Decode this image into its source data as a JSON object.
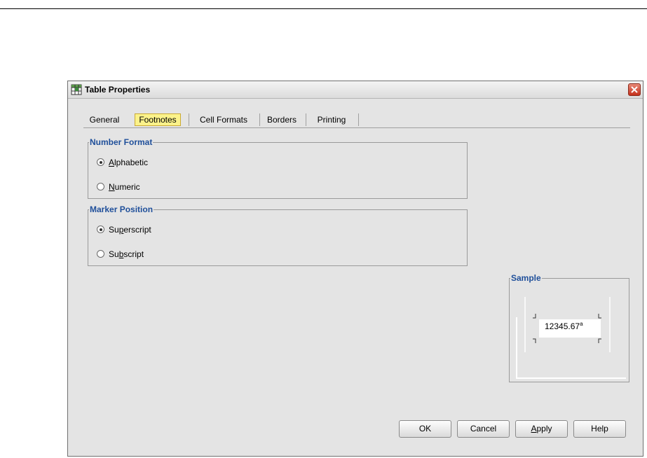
{
  "window": {
    "title": "Table Properties"
  },
  "tabs": [
    {
      "label": "General",
      "active": false
    },
    {
      "label": "Footnotes",
      "active": true
    },
    {
      "label": "Cell Formats",
      "active": false
    },
    {
      "label": "Borders",
      "active": false
    },
    {
      "label": "Printing",
      "active": false
    }
  ],
  "number_format": {
    "legend": "Number Format",
    "options": [
      {
        "label": "Alphabetic",
        "mnemonic": "A",
        "checked": true
      },
      {
        "label": "Numeric",
        "mnemonic": "N",
        "checked": false
      }
    ]
  },
  "marker_position": {
    "legend": "Marker Position",
    "options": [
      {
        "label": "Superscript",
        "mnemonic": "p",
        "checked": true
      },
      {
        "label": "Subscript",
        "mnemonic": "b",
        "checked": false
      }
    ]
  },
  "sample": {
    "legend": "Sample",
    "value": "12345.67",
    "marker": "a"
  },
  "buttons": {
    "ok": "OK",
    "cancel": "Cancel",
    "apply": "Apply",
    "apply_mnemonic": "A",
    "help": "Help"
  },
  "colors": {
    "legend_text": "#1f4f9a",
    "active_tab": "#fbf28a",
    "dialog_bg": "#e4e4e4",
    "close_button": "#c4301c"
  },
  "icons": {
    "app": "table-grid-icon",
    "close": "close-icon"
  }
}
